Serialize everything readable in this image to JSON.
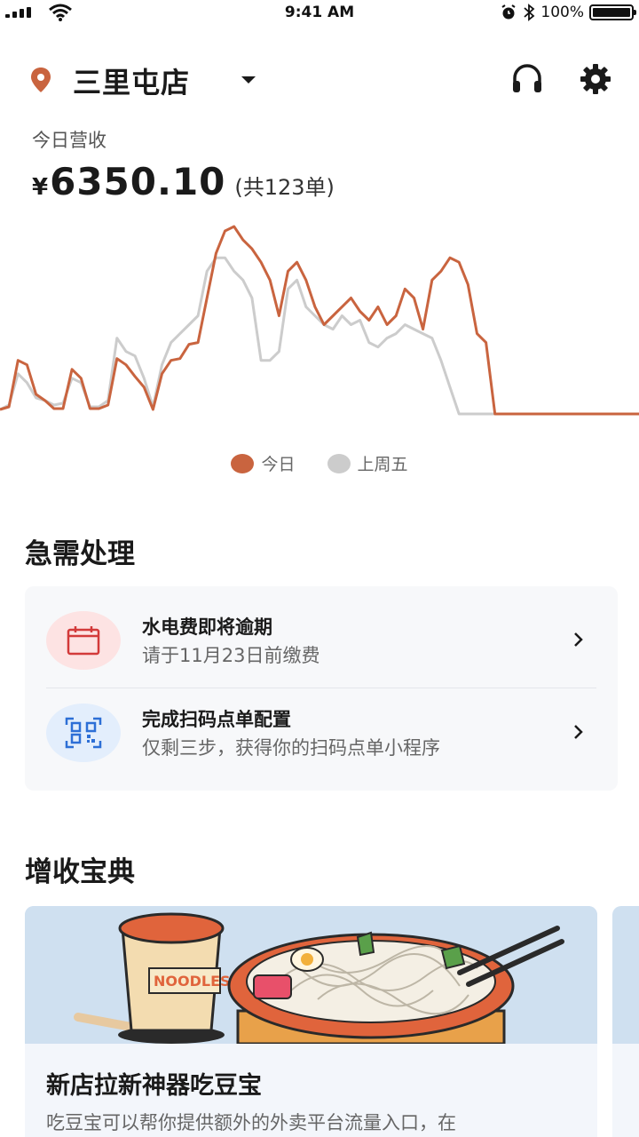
{
  "status_bar": {
    "time": "9:41 AM",
    "battery": "100%"
  },
  "header": {
    "store_name": "三里屯店"
  },
  "revenue": {
    "label": "今日营收",
    "currency": "¥",
    "amount": "6350.10",
    "orders": "(共123单)"
  },
  "chart_data": {
    "type": "line",
    "x": [
      0,
      1,
      2,
      3,
      4,
      5,
      6,
      7,
      8,
      9,
      10,
      11,
      12,
      13,
      14,
      15,
      16,
      17,
      18,
      19,
      20,
      21,
      22,
      23,
      24,
      25,
      26,
      27,
      28,
      29,
      30,
      31,
      32,
      33,
      34,
      35,
      36,
      37,
      38,
      39,
      40,
      41,
      42,
      43,
      44,
      45,
      46,
      47,
      48,
      49,
      50,
      51,
      52,
      53,
      54,
      55,
      56,
      57,
      58,
      59,
      60,
      61,
      62,
      63,
      64,
      65,
      66,
      67,
      68,
      69,
      70,
      71
    ],
    "series": [
      {
        "name": "今日",
        "color": "#c9643f",
        "values": [
          5,
          8,
          60,
          55,
          22,
          15,
          6,
          6,
          50,
          40,
          6,
          6,
          10,
          62,
          55,
          42,
          30,
          5,
          45,
          60,
          62,
          78,
          80,
          130,
          180,
          205,
          210,
          195,
          185,
          170,
          150,
          110,
          160,
          170,
          150,
          120,
          100,
          110,
          120,
          130,
          115,
          105,
          120,
          100,
          110,
          140,
          130,
          95,
          150,
          160,
          175,
          170,
          145,
          90,
          80,
          0,
          0,
          0,
          0,
          0,
          0,
          0,
          0,
          0,
          0,
          0,
          0,
          0,
          0,
          0,
          0,
          0
        ]
      },
      {
        "name": "上周五",
        "color": "#cccccc",
        "values": [
          5,
          10,
          45,
          35,
          18,
          15,
          10,
          12,
          40,
          35,
          8,
          8,
          15,
          85,
          70,
          65,
          40,
          8,
          55,
          80,
          90,
          100,
          110,
          160,
          175,
          175,
          160,
          150,
          130,
          60,
          60,
          70,
          140,
          150,
          120,
          110,
          100,
          95,
          110,
          100,
          105,
          80,
          75,
          85,
          90,
          100,
          95,
          90,
          85,
          60,
          30,
          0,
          0,
          0,
          0,
          0,
          0,
          0,
          0,
          0,
          0,
          0,
          0,
          0,
          0,
          0,
          0,
          0,
          0,
          0,
          0,
          0
        ]
      }
    ],
    "legend": [
      "今日",
      "上周五"
    ],
    "legend_position": "bottom-center",
    "grid": false
  },
  "urgent": {
    "title": "急需处理",
    "tasks": [
      {
        "title": "水电费即将逾期",
        "subtitle": "请于11月23日前缴费",
        "icon": "calendar-icon"
      },
      {
        "title": "完成扫码点单配置",
        "subtitle": "仅剩三步，获得你的扫码点单小程序",
        "icon": "qr-scan-icon"
      }
    ]
  },
  "growth": {
    "title": "增收宝典",
    "cards": [
      {
        "title": "新店拉新神器吃豆宝",
        "desc": "吃豆宝可以帮你提供额外的外卖平台流量入口，在",
        "image_text": "NOODLES"
      }
    ]
  },
  "colors": {
    "accent": "#c9643f",
    "compare": "#cccccc",
    "urgent_red": "#d33a3a",
    "qr_blue": "#2d6fd6"
  }
}
